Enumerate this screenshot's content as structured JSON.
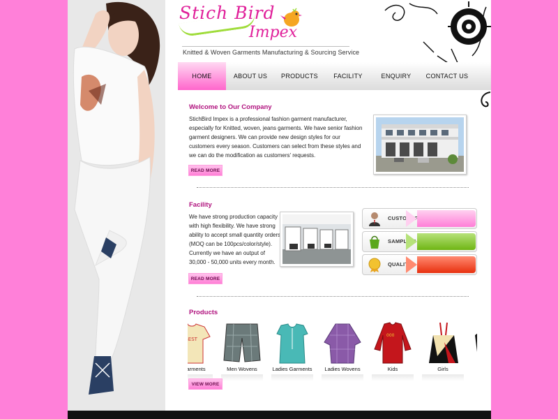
{
  "brand": {
    "logo_line1": "Stich Bird",
    "logo_line2": "Impex",
    "tagline": "Knitted & Woven Garments Manufacturing & Sourcing Service"
  },
  "nav": {
    "items": [
      {
        "label": "HOME",
        "active": true
      },
      {
        "label": "ABOUT US",
        "active": false
      },
      {
        "label": "PRODUCTS",
        "active": false
      },
      {
        "label": "FACILITY",
        "active": false
      },
      {
        "label": "ENQUIRY",
        "active": false
      },
      {
        "label": "CONTACT US",
        "active": false
      }
    ]
  },
  "welcome": {
    "title": "Welcome to Our Company",
    "text": "StichBird Impex is a professional fashion garment manufacturer, especially for Knitted, woven, jeans garments. We have senior fashion garment designers. We can provide new design styles for our customers every season. Customers can select from these styles and we can do the modification as customers' requests.",
    "button": "READ MORE"
  },
  "facility": {
    "title": "Facility",
    "text": "We have strong production capacity with high flexibility. We have strong ability to accept small quantity orders (MOQ can be 100pcs/color/style). Currently we have an output of 30,000 - 50,000 units every month.",
    "button": "READ MORE",
    "boxes": [
      {
        "label": "CUSTOMER",
        "icon": "customer-icon",
        "color": "#ff7ed8"
      },
      {
        "label": "SAMPLING",
        "icon": "bag-icon",
        "color": "#7cc21e"
      },
      {
        "label": "QUALITY",
        "icon": "quality-badge-icon",
        "color": "#f03a1c"
      }
    ]
  },
  "products": {
    "title": "Products",
    "items": [
      {
        "caption": "n Garments"
      },
      {
        "caption": "Men Wovens"
      },
      {
        "caption": "Ladies Garments"
      },
      {
        "caption": "Ladies Wovens"
      },
      {
        "caption": "Kids"
      },
      {
        "caption": "Girls"
      }
    ],
    "button": "VIEW MORE"
  },
  "colors": {
    "page_background": "#ff80d9",
    "accent": "#b0127e",
    "nav_active": "#ff66cc"
  }
}
